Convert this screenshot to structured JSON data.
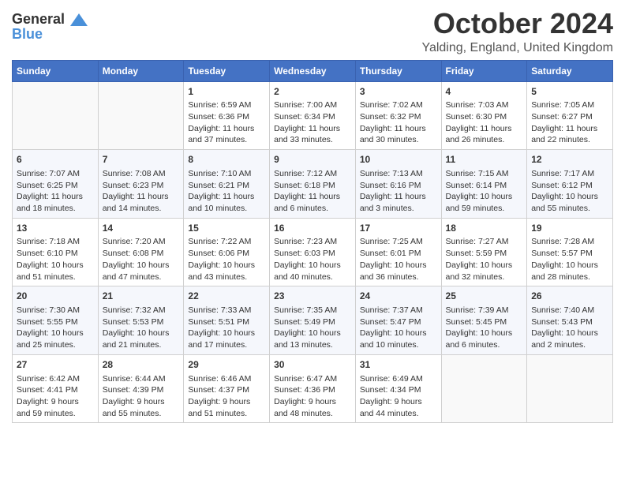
{
  "header": {
    "logo_line1": "General",
    "logo_line2": "Blue",
    "month_title": "October 2024",
    "location": "Yalding, England, United Kingdom"
  },
  "days_of_week": [
    "Sunday",
    "Monday",
    "Tuesday",
    "Wednesday",
    "Thursday",
    "Friday",
    "Saturday"
  ],
  "weeks": [
    [
      {
        "day": "",
        "info": ""
      },
      {
        "day": "",
        "info": ""
      },
      {
        "day": "1",
        "info": "Sunrise: 6:59 AM\nSunset: 6:36 PM\nDaylight: 11 hours\nand 37 minutes."
      },
      {
        "day": "2",
        "info": "Sunrise: 7:00 AM\nSunset: 6:34 PM\nDaylight: 11 hours\nand 33 minutes."
      },
      {
        "day": "3",
        "info": "Sunrise: 7:02 AM\nSunset: 6:32 PM\nDaylight: 11 hours\nand 30 minutes."
      },
      {
        "day": "4",
        "info": "Sunrise: 7:03 AM\nSunset: 6:30 PM\nDaylight: 11 hours\nand 26 minutes."
      },
      {
        "day": "5",
        "info": "Sunrise: 7:05 AM\nSunset: 6:27 PM\nDaylight: 11 hours\nand 22 minutes."
      }
    ],
    [
      {
        "day": "6",
        "info": "Sunrise: 7:07 AM\nSunset: 6:25 PM\nDaylight: 11 hours\nand 18 minutes."
      },
      {
        "day": "7",
        "info": "Sunrise: 7:08 AM\nSunset: 6:23 PM\nDaylight: 11 hours\nand 14 minutes."
      },
      {
        "day": "8",
        "info": "Sunrise: 7:10 AM\nSunset: 6:21 PM\nDaylight: 11 hours\nand 10 minutes."
      },
      {
        "day": "9",
        "info": "Sunrise: 7:12 AM\nSunset: 6:18 PM\nDaylight: 11 hours\nand 6 minutes."
      },
      {
        "day": "10",
        "info": "Sunrise: 7:13 AM\nSunset: 6:16 PM\nDaylight: 11 hours\nand 3 minutes."
      },
      {
        "day": "11",
        "info": "Sunrise: 7:15 AM\nSunset: 6:14 PM\nDaylight: 10 hours\nand 59 minutes."
      },
      {
        "day": "12",
        "info": "Sunrise: 7:17 AM\nSunset: 6:12 PM\nDaylight: 10 hours\nand 55 minutes."
      }
    ],
    [
      {
        "day": "13",
        "info": "Sunrise: 7:18 AM\nSunset: 6:10 PM\nDaylight: 10 hours\nand 51 minutes."
      },
      {
        "day": "14",
        "info": "Sunrise: 7:20 AM\nSunset: 6:08 PM\nDaylight: 10 hours\nand 47 minutes."
      },
      {
        "day": "15",
        "info": "Sunrise: 7:22 AM\nSunset: 6:06 PM\nDaylight: 10 hours\nand 43 minutes."
      },
      {
        "day": "16",
        "info": "Sunrise: 7:23 AM\nSunset: 6:03 PM\nDaylight: 10 hours\nand 40 minutes."
      },
      {
        "day": "17",
        "info": "Sunrise: 7:25 AM\nSunset: 6:01 PM\nDaylight: 10 hours\nand 36 minutes."
      },
      {
        "day": "18",
        "info": "Sunrise: 7:27 AM\nSunset: 5:59 PM\nDaylight: 10 hours\nand 32 minutes."
      },
      {
        "day": "19",
        "info": "Sunrise: 7:28 AM\nSunset: 5:57 PM\nDaylight: 10 hours\nand 28 minutes."
      }
    ],
    [
      {
        "day": "20",
        "info": "Sunrise: 7:30 AM\nSunset: 5:55 PM\nDaylight: 10 hours\nand 25 minutes."
      },
      {
        "day": "21",
        "info": "Sunrise: 7:32 AM\nSunset: 5:53 PM\nDaylight: 10 hours\nand 21 minutes."
      },
      {
        "day": "22",
        "info": "Sunrise: 7:33 AM\nSunset: 5:51 PM\nDaylight: 10 hours\nand 17 minutes."
      },
      {
        "day": "23",
        "info": "Sunrise: 7:35 AM\nSunset: 5:49 PM\nDaylight: 10 hours\nand 13 minutes."
      },
      {
        "day": "24",
        "info": "Sunrise: 7:37 AM\nSunset: 5:47 PM\nDaylight: 10 hours\nand 10 minutes."
      },
      {
        "day": "25",
        "info": "Sunrise: 7:39 AM\nSunset: 5:45 PM\nDaylight: 10 hours\nand 6 minutes."
      },
      {
        "day": "26",
        "info": "Sunrise: 7:40 AM\nSunset: 5:43 PM\nDaylight: 10 hours\nand 2 minutes."
      }
    ],
    [
      {
        "day": "27",
        "info": "Sunrise: 6:42 AM\nSunset: 4:41 PM\nDaylight: 9 hours\nand 59 minutes."
      },
      {
        "day": "28",
        "info": "Sunrise: 6:44 AM\nSunset: 4:39 PM\nDaylight: 9 hours\nand 55 minutes."
      },
      {
        "day": "29",
        "info": "Sunrise: 6:46 AM\nSunset: 4:37 PM\nDaylight: 9 hours\nand 51 minutes."
      },
      {
        "day": "30",
        "info": "Sunrise: 6:47 AM\nSunset: 4:36 PM\nDaylight: 9 hours\nand 48 minutes."
      },
      {
        "day": "31",
        "info": "Sunrise: 6:49 AM\nSunset: 4:34 PM\nDaylight: 9 hours\nand 44 minutes."
      },
      {
        "day": "",
        "info": ""
      },
      {
        "day": "",
        "info": ""
      }
    ]
  ]
}
